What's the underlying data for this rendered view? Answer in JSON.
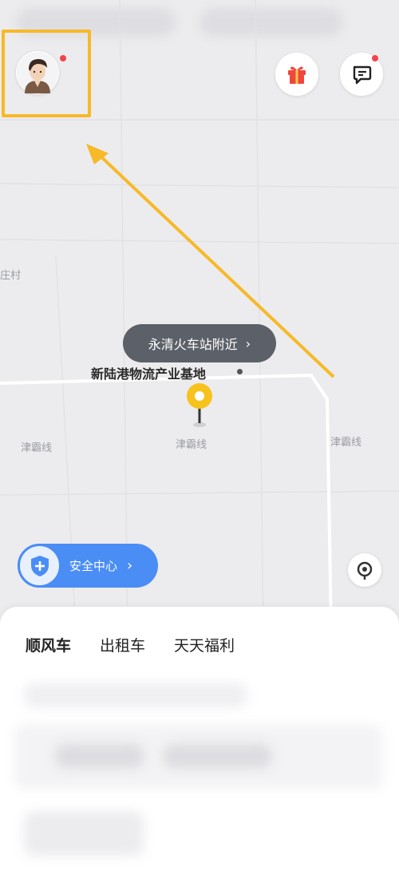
{
  "map": {
    "labels": {
      "village": "庄村",
      "road_left": "津霸线",
      "road_center": "津霸线",
      "road_right": "津霸线"
    },
    "poi_name": "新陆港物流产业基地",
    "location_bubble": "永清火车站附近"
  },
  "header": {
    "avatar_icon": "user-avatar",
    "gift_icon": "gift-icon",
    "message_icon": "message-icon",
    "notification_color": "#f2434a"
  },
  "safety": {
    "label": "安全中心",
    "color": "#4a8df5"
  },
  "tabs": [
    {
      "label": "顺风车",
      "active": true
    },
    {
      "label": "出租车",
      "active": false
    },
    {
      "label": "天天福利",
      "active": false
    }
  ],
  "colors": {
    "accent": "#f7c94a",
    "annotation": "#f7b927"
  }
}
